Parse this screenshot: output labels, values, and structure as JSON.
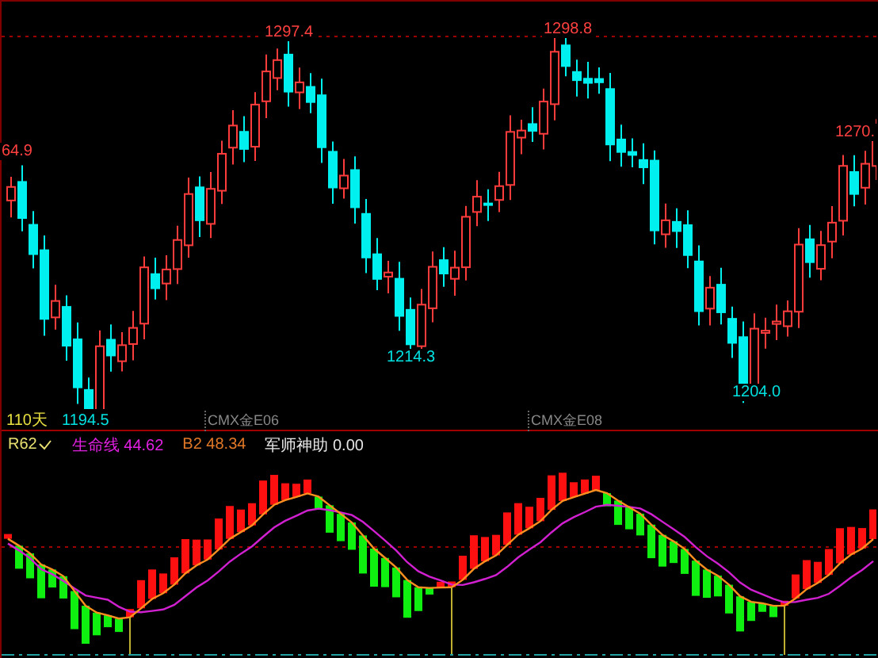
{
  "price_chart": {
    "labels": [
      {
        "text": "64.9",
        "kind": "high"
      },
      {
        "text": "1297.4",
        "kind": "high"
      },
      {
        "text": "1298.8",
        "kind": "high"
      },
      {
        "text": "1270.",
        "kind": "high"
      },
      {
        "text": "1214.3",
        "kind": "low"
      },
      {
        "text": "1204.0",
        "kind": "low"
      }
    ],
    "period": "110天",
    "low": "1194.5",
    "contracts": [
      "CMX金E06",
      "CMX金E08"
    ]
  },
  "indicator": {
    "name": "R62",
    "values": [
      {
        "text": "生命线 44.62",
        "color": "#e020e0"
      },
      {
        "text": "B2 48.34",
        "color": "#e07828"
      },
      {
        "text": "军师神助 0.00",
        "color": "#e8e8e8"
      }
    ]
  }
}
